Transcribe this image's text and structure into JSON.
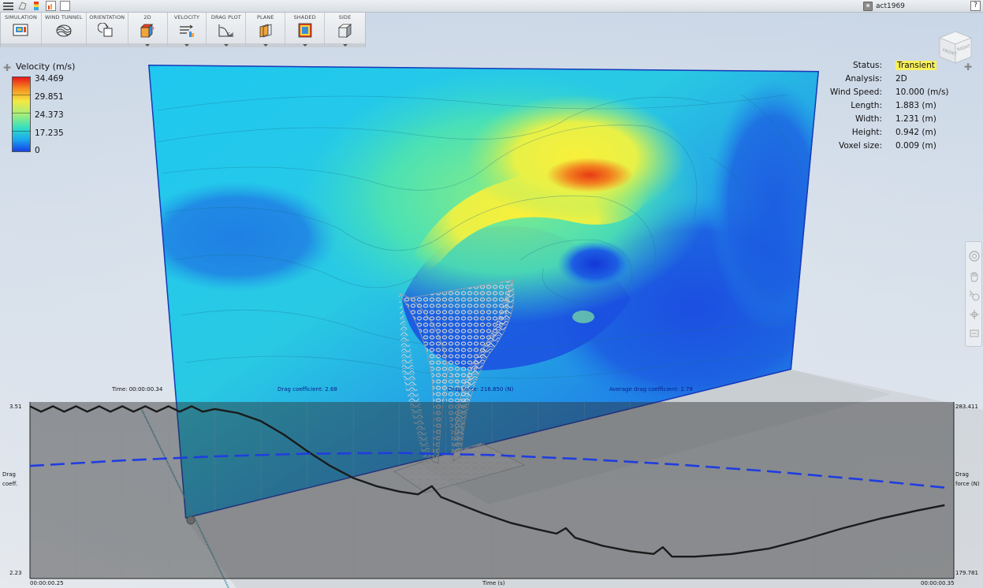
{
  "topbar": {
    "user_name": "act1969",
    "help_label": "?"
  },
  "ribbon": {
    "items": [
      {
        "label": "SIMULATION",
        "icon": "simulation-icon",
        "dropdown": false
      },
      {
        "label": "WIND TUNNEL",
        "icon": "wind-tunnel-icon",
        "dropdown": false
      },
      {
        "label": "ORIENTATION",
        "icon": "orientation-icon",
        "dropdown": false
      },
      {
        "label": "2D",
        "icon": "2d-icon",
        "dropdown": true
      },
      {
        "label": "VELOCITY",
        "icon": "velocity-icon",
        "dropdown": true
      },
      {
        "label": "DRAG PLOT",
        "icon": "drag-plot-icon",
        "dropdown": true
      },
      {
        "label": "PLANE",
        "icon": "plane-icon",
        "dropdown": true
      },
      {
        "label": "SHADED",
        "icon": "shaded-icon",
        "dropdown": true
      },
      {
        "label": "SIDE",
        "icon": "side-icon",
        "dropdown": true
      }
    ]
  },
  "legend": {
    "title": "Velocity (m/s)",
    "values": [
      "34.469",
      "29.851",
      "24.373",
      "17.235",
      "0"
    ]
  },
  "status": {
    "rows": [
      {
        "label": "Status:",
        "value": "Transient",
        "highlight": true
      },
      {
        "label": "Analysis:",
        "value": "2D",
        "highlight": false
      },
      {
        "label": "Wind Speed:",
        "value": "10.000 (m/s)",
        "highlight": false
      },
      {
        "label": "Length:",
        "value": "1.883 (m)",
        "highlight": false
      },
      {
        "label": "Width:",
        "value": "1.231 (m)",
        "highlight": false
      },
      {
        "label": "Height:",
        "value": "0.942 (m)",
        "highlight": false
      },
      {
        "label": "Voxel size:",
        "value": "0.009 (m)",
        "highlight": false
      }
    ],
    "highlight_color": "#f7f05c"
  },
  "viewcube": {
    "front_label": "FRONT",
    "right_label": "RIGHT"
  },
  "plot": {
    "time_label": "Time: 00:00:00.34",
    "drag_coefficient_label": "Drag coefficient: 2.68",
    "drag_force_label": "Drag force: 216.850 (N)",
    "avg_drag_label": "Average drag coefficient: 2.78",
    "y_left_max": "3.51",
    "y_left_min": "2.23",
    "y_right_max": "283.411",
    "y_right_min": "179.781",
    "y_left_title_1": "Drag",
    "y_left_title_2": "coeff.",
    "y_right_title_1": "Drag",
    "y_right_title_2": "force (N)",
    "x_start": "00:00:00.25",
    "x_end": "00:00:00.35",
    "x_title": "Time (s)"
  },
  "chart_data": {
    "type": "line",
    "x_range": [
      0.25,
      0.35
    ],
    "series": [
      {
        "name": "Drag coefficient",
        "axis": "left",
        "color": "#1a1a1a",
        "style": "solid",
        "ylim": [
          2.23,
          3.51
        ],
        "x": [
          0.25,
          0.2512,
          0.2525,
          0.2537,
          0.255,
          0.2562,
          0.2575,
          0.2587,
          0.26,
          0.2612,
          0.2625,
          0.2637,
          0.265,
          0.2662,
          0.2675,
          0.2687,
          0.27,
          0.2725,
          0.275,
          0.2775,
          0.28,
          0.2825,
          0.285,
          0.2875,
          0.29,
          0.292,
          0.2935,
          0.2945,
          0.296,
          0.299,
          0.302,
          0.305,
          0.307,
          0.308,
          0.309,
          0.312,
          0.315,
          0.3175,
          0.3185,
          0.3195,
          0.322,
          0.326,
          0.33,
          0.334,
          0.338,
          0.342,
          0.346,
          0.349
        ],
        "values": [
          3.49,
          3.45,
          3.49,
          3.45,
          3.49,
          3.45,
          3.49,
          3.45,
          3.49,
          3.45,
          3.49,
          3.45,
          3.49,
          3.45,
          3.49,
          3.45,
          3.47,
          3.44,
          3.38,
          3.28,
          3.16,
          3.05,
          2.96,
          2.9,
          2.86,
          2.84,
          2.9,
          2.82,
          2.78,
          2.7,
          2.63,
          2.58,
          2.55,
          2.59,
          2.52,
          2.46,
          2.42,
          2.4,
          2.45,
          2.38,
          2.38,
          2.4,
          2.44,
          2.51,
          2.59,
          2.66,
          2.72,
          2.76
        ]
      },
      {
        "name": "Average drag coefficient",
        "axis": "left",
        "color": "#1f3de0",
        "style": "dashed",
        "ylim": [
          2.23,
          3.51
        ],
        "x": [
          0.25,
          0.26,
          0.27,
          0.28,
          0.29,
          0.3,
          0.31,
          0.32,
          0.33,
          0.34,
          0.349
        ],
        "values": [
          3.05,
          3.09,
          3.12,
          3.14,
          3.145,
          3.13,
          3.1,
          3.06,
          3.01,
          2.95,
          2.89
        ]
      }
    ]
  }
}
